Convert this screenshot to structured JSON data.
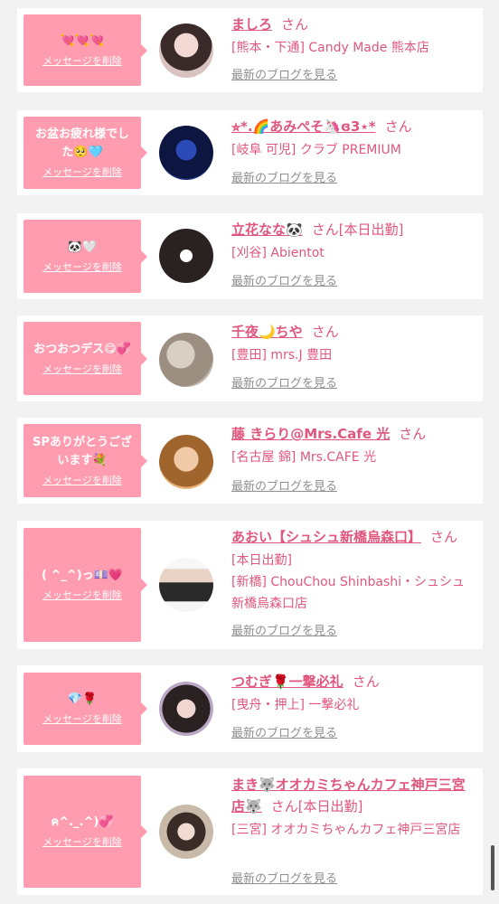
{
  "delete_label": "メッセージを削除",
  "blog_label": "最新のブログを見る",
  "honorific": "さん",
  "colors": {
    "accent_pink": "#ff9cb0",
    "name_pink": "#e0577e",
    "link_gray": "#8f8f8f"
  },
  "items": [
    {
      "message": "💘💘💘",
      "name": "ましろ",
      "tag": "",
      "shop": "[熊本・下通] Candy Made 熊本店"
    },
    {
      "message": "お盆お疲れ様でした🥺🩵",
      "name": "⭐︎*.🌈あみぺそ🦄ɞ3⋆*",
      "tag": "",
      "shop": "[岐阜 可児] クラブ PREMIUM"
    },
    {
      "message": "🐼🤍",
      "name": "立花なな🐼",
      "tag": "[本日出勤]",
      "shop": "[刈谷] Abientot"
    },
    {
      "message": "おつおつデス😋💞",
      "name": "千夜🌙ちや",
      "tag": "",
      "shop": "[豊田] mrs.J 豊田"
    },
    {
      "message": "SPありがとうございます💐",
      "name": "藤 きらり@Mrs.Cafe 光",
      "tag": "",
      "shop": "[名古屋 錦] Mrs.CAFE 光"
    },
    {
      "message": "( ^_^)っ💷💗",
      "name": "あおい【シュシュ新橋烏森口】",
      "tag": "",
      "status": "[本日出勤]",
      "shop": "[新橋] ChouChou Shinbashi・シュシュ新橋烏森口店"
    },
    {
      "message": "💎🌹",
      "name": "つむぎ🌹一撃必礼",
      "tag": "",
      "shop": "[曳舟・押上] 一撃必礼"
    },
    {
      "message": "ฅ^._.^)💞",
      "name": "まき🐺オオカミちゃんカフェ神戸三宮店🐺",
      "tag": "[本日出勤]",
      "shop": "[三宮] オオカミちゃんカフェ神戸三宮店"
    }
  ]
}
